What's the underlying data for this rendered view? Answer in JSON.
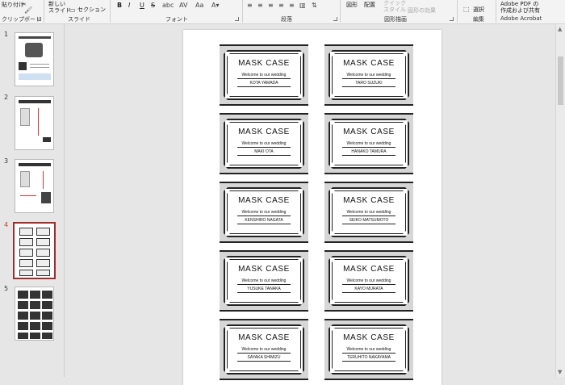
{
  "ribbon": {
    "clipboard": {
      "paste_label": "貼り付け",
      "group_label": "クリップボード"
    },
    "slides": {
      "new_slide_label": "新しい\nスライド",
      "section_label": "セクション",
      "group_label": "スライド"
    },
    "font": {
      "bold": "B",
      "italic": "I",
      "underline": "U",
      "strike": "S",
      "group_label": "フォント"
    },
    "paragraph": {
      "group_label": "段落"
    },
    "drawing": {
      "shapes_label": "図形",
      "arrange_label": "配置",
      "quick_styles_label": "クイック\nスタイル",
      "effects_label": "図形の効果",
      "group_label": "図形描画"
    },
    "editing": {
      "select_label": "選択",
      "group_label": "編集"
    },
    "acrobat": {
      "create_label": "Adobe PDF の\n作成および共有",
      "group_label": "Adobe Acrobat"
    }
  },
  "thumbnails": [
    {
      "number": "1",
      "active": false
    },
    {
      "number": "2",
      "active": false
    },
    {
      "number": "3",
      "active": false
    },
    {
      "number": "4",
      "active": true
    },
    {
      "number": "5",
      "active": false
    }
  ],
  "slide": {
    "cards": [
      {
        "title": "MASK  CASE",
        "welcome": "Welcome  to  our  wedding",
        "name": "KOTA YAMADA"
      },
      {
        "title": "MASK  CASE",
        "welcome": "Welcome  to  our  wedding",
        "name": "TARO SUZUKI"
      },
      {
        "title": "MASK  CASE",
        "welcome": "Welcome  to  our  wedding",
        "name": "MAKI OTA"
      },
      {
        "title": "MASK  CASE",
        "welcome": "Welcome  to  our  wedding",
        "name": "HANAKO TAMURA"
      },
      {
        "title": "MASK  CASE",
        "welcome": "Welcome  to  our  wedding",
        "name": "KENSHIRO NAGATA"
      },
      {
        "title": "MASK  CASE",
        "welcome": "Welcome  to  our  wedding",
        "name": "SEIKO MATSUMOTO"
      },
      {
        "title": "MASK  CASE",
        "welcome": "Welcome  to  our  wedding",
        "name": "YUSUKE TANAKA"
      },
      {
        "title": "MASK  CASE",
        "welcome": "Welcome  to  our  wedding",
        "name": "KAYO MURATA"
      },
      {
        "title": "MASK  CASE",
        "welcome": "Welcome  to  our  wedding",
        "name": "SAYAKA SHIMIZU"
      },
      {
        "title": "MASK  CASE",
        "welcome": "Welcome  to  our  wedding",
        "name": "TERUHITO NAKAYAMA"
      }
    ]
  },
  "colors": {
    "active_thumb_border": "#a22b2b",
    "active_number": "#c43e1c",
    "card_background": "#d6d6d6"
  }
}
